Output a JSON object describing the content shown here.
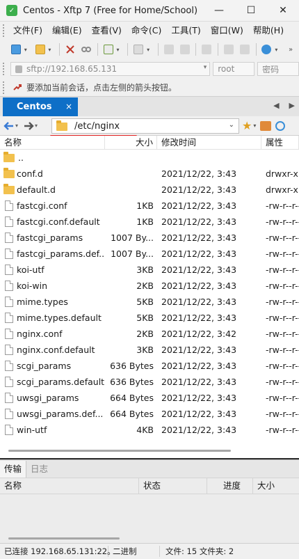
{
  "window": {
    "title": "Centos - Xftp 7 (Free for Home/School)",
    "minimize": "—",
    "maximize": "☐",
    "close": "✕"
  },
  "menu": {
    "items": [
      "文件(F)",
      "编辑(E)",
      "查看(V)",
      "命令(C)",
      "工具(T)",
      "窗口(W)",
      "帮助(H)"
    ]
  },
  "address": {
    "host": "sftp://192.168.65.131",
    "user_placeholder": "root",
    "password_placeholder": "密码"
  },
  "hint": {
    "text": "要添加当前会话，点击左侧的箭头按钮。"
  },
  "tabs": {
    "active_label": "Centos",
    "close_glyph": "×"
  },
  "path": {
    "current": "/etc/nginx"
  },
  "columns": {
    "name": "名称",
    "size": "大小",
    "modified": "修改时间",
    "attr": "属性"
  },
  "parent_label": "..",
  "files": [
    {
      "name": "conf.d",
      "type": "folder",
      "size": "",
      "modified": "2021/12/22, 3:43",
      "attr": "drwxr-xr-x"
    },
    {
      "name": "default.d",
      "type": "folder",
      "size": "",
      "modified": "2021/12/22, 3:43",
      "attr": "drwxr-xr-x"
    },
    {
      "name": "fastcgi.conf",
      "type": "file",
      "size": "1KB",
      "modified": "2021/12/22, 3:43",
      "attr": "-rw-r--r--"
    },
    {
      "name": "fastcgi.conf.default",
      "type": "file",
      "size": "1KB",
      "modified": "2021/12/22, 3:43",
      "attr": "-rw-r--r--"
    },
    {
      "name": "fastcgi_params",
      "type": "file",
      "size": "1007 By...",
      "modified": "2021/12/22, 3:43",
      "attr": "-rw-r--r--"
    },
    {
      "name": "fastcgi_params.def...",
      "type": "file",
      "size": "1007 By...",
      "modified": "2021/12/22, 3:43",
      "attr": "-rw-r--r--"
    },
    {
      "name": "koi-utf",
      "type": "file",
      "size": "3KB",
      "modified": "2021/12/22, 3:43",
      "attr": "-rw-r--r--"
    },
    {
      "name": "koi-win",
      "type": "file",
      "size": "2KB",
      "modified": "2021/12/22, 3:43",
      "attr": "-rw-r--r--"
    },
    {
      "name": "mime.types",
      "type": "file",
      "size": "5KB",
      "modified": "2021/12/22, 3:43",
      "attr": "-rw-r--r--"
    },
    {
      "name": "mime.types.default",
      "type": "file",
      "size": "5KB",
      "modified": "2021/12/22, 3:43",
      "attr": "-rw-r--r--"
    },
    {
      "name": "nginx.conf",
      "type": "file",
      "size": "2KB",
      "modified": "2021/12/22, 3:42",
      "attr": "-rw-r--r--"
    },
    {
      "name": "nginx.conf.default",
      "type": "file",
      "size": "3KB",
      "modified": "2021/12/22, 3:43",
      "attr": "-rw-r--r--"
    },
    {
      "name": "scgi_params",
      "type": "file",
      "size": "636 Bytes",
      "modified": "2021/12/22, 3:43",
      "attr": "-rw-r--r--"
    },
    {
      "name": "scgi_params.default",
      "type": "file",
      "size": "636 Bytes",
      "modified": "2021/12/22, 3:43",
      "attr": "-rw-r--r--"
    },
    {
      "name": "uwsgi_params",
      "type": "file",
      "size": "664 Bytes",
      "modified": "2021/12/22, 3:43",
      "attr": "-rw-r--r--"
    },
    {
      "name": "uwsgi_params.def...",
      "type": "file",
      "size": "664 Bytes",
      "modified": "2021/12/22, 3:43",
      "attr": "-rw-r--r--"
    },
    {
      "name": "win-utf",
      "type": "file",
      "size": "4KB",
      "modified": "2021/12/22, 3:43",
      "attr": "-rw-r--r--"
    }
  ],
  "transfer": {
    "tab_active": "传输",
    "tab_log": "日志",
    "columns": [
      "名称",
      "状态",
      "进度",
      "大小"
    ]
  },
  "status": {
    "connection": "已连接 192.168.65.131:22。",
    "mode": "二进制",
    "counts": "文件: 15  文件夹: 2"
  },
  "colors": {
    "accent": "#0e6fc7",
    "folder": "#f2c14e",
    "underline": "#e02020"
  }
}
